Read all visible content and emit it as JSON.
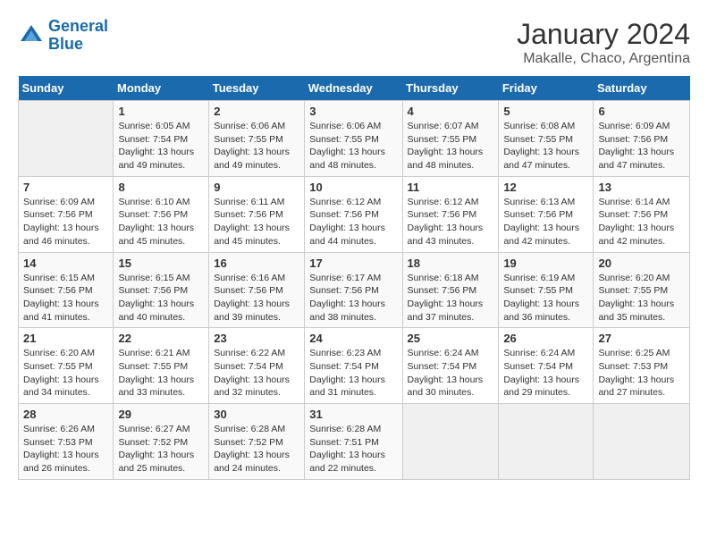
{
  "header": {
    "logo_line1": "General",
    "logo_line2": "Blue",
    "title": "January 2024",
    "subtitle": "Makalle, Chaco, Argentina"
  },
  "weekdays": [
    "Sunday",
    "Monday",
    "Tuesday",
    "Wednesday",
    "Thursday",
    "Friday",
    "Saturday"
  ],
  "weeks": [
    [
      {
        "day": "",
        "sunrise": "",
        "sunset": "",
        "daylight": ""
      },
      {
        "day": "1",
        "sunrise": "6:05 AM",
        "sunset": "7:54 PM",
        "daylight": "13 hours and 49 minutes."
      },
      {
        "day": "2",
        "sunrise": "6:06 AM",
        "sunset": "7:55 PM",
        "daylight": "13 hours and 49 minutes."
      },
      {
        "day": "3",
        "sunrise": "6:06 AM",
        "sunset": "7:55 PM",
        "daylight": "13 hours and 48 minutes."
      },
      {
        "day": "4",
        "sunrise": "6:07 AM",
        "sunset": "7:55 PM",
        "daylight": "13 hours and 48 minutes."
      },
      {
        "day": "5",
        "sunrise": "6:08 AM",
        "sunset": "7:55 PM",
        "daylight": "13 hours and 47 minutes."
      },
      {
        "day": "6",
        "sunrise": "6:09 AM",
        "sunset": "7:56 PM",
        "daylight": "13 hours and 47 minutes."
      }
    ],
    [
      {
        "day": "7",
        "sunrise": "6:09 AM",
        "sunset": "7:56 PM",
        "daylight": "13 hours and 46 minutes."
      },
      {
        "day": "8",
        "sunrise": "6:10 AM",
        "sunset": "7:56 PM",
        "daylight": "13 hours and 45 minutes."
      },
      {
        "day": "9",
        "sunrise": "6:11 AM",
        "sunset": "7:56 PM",
        "daylight": "13 hours and 45 minutes."
      },
      {
        "day": "10",
        "sunrise": "6:12 AM",
        "sunset": "7:56 PM",
        "daylight": "13 hours and 44 minutes."
      },
      {
        "day": "11",
        "sunrise": "6:12 AM",
        "sunset": "7:56 PM",
        "daylight": "13 hours and 43 minutes."
      },
      {
        "day": "12",
        "sunrise": "6:13 AM",
        "sunset": "7:56 PM",
        "daylight": "13 hours and 42 minutes."
      },
      {
        "day": "13",
        "sunrise": "6:14 AM",
        "sunset": "7:56 PM",
        "daylight": "13 hours and 42 minutes."
      }
    ],
    [
      {
        "day": "14",
        "sunrise": "6:15 AM",
        "sunset": "7:56 PM",
        "daylight": "13 hours and 41 minutes."
      },
      {
        "day": "15",
        "sunrise": "6:15 AM",
        "sunset": "7:56 PM",
        "daylight": "13 hours and 40 minutes."
      },
      {
        "day": "16",
        "sunrise": "6:16 AM",
        "sunset": "7:56 PM",
        "daylight": "13 hours and 39 minutes."
      },
      {
        "day": "17",
        "sunrise": "6:17 AM",
        "sunset": "7:56 PM",
        "daylight": "13 hours and 38 minutes."
      },
      {
        "day": "18",
        "sunrise": "6:18 AM",
        "sunset": "7:56 PM",
        "daylight": "13 hours and 37 minutes."
      },
      {
        "day": "19",
        "sunrise": "6:19 AM",
        "sunset": "7:55 PM",
        "daylight": "13 hours and 36 minutes."
      },
      {
        "day": "20",
        "sunrise": "6:20 AM",
        "sunset": "7:55 PM",
        "daylight": "13 hours and 35 minutes."
      }
    ],
    [
      {
        "day": "21",
        "sunrise": "6:20 AM",
        "sunset": "7:55 PM",
        "daylight": "13 hours and 34 minutes."
      },
      {
        "day": "22",
        "sunrise": "6:21 AM",
        "sunset": "7:55 PM",
        "daylight": "13 hours and 33 minutes."
      },
      {
        "day": "23",
        "sunrise": "6:22 AM",
        "sunset": "7:54 PM",
        "daylight": "13 hours and 32 minutes."
      },
      {
        "day": "24",
        "sunrise": "6:23 AM",
        "sunset": "7:54 PM",
        "daylight": "13 hours and 31 minutes."
      },
      {
        "day": "25",
        "sunrise": "6:24 AM",
        "sunset": "7:54 PM",
        "daylight": "13 hours and 30 minutes."
      },
      {
        "day": "26",
        "sunrise": "6:24 AM",
        "sunset": "7:54 PM",
        "daylight": "13 hours and 29 minutes."
      },
      {
        "day": "27",
        "sunrise": "6:25 AM",
        "sunset": "7:53 PM",
        "daylight": "13 hours and 27 minutes."
      }
    ],
    [
      {
        "day": "28",
        "sunrise": "6:26 AM",
        "sunset": "7:53 PM",
        "daylight": "13 hours and 26 minutes."
      },
      {
        "day": "29",
        "sunrise": "6:27 AM",
        "sunset": "7:52 PM",
        "daylight": "13 hours and 25 minutes."
      },
      {
        "day": "30",
        "sunrise": "6:28 AM",
        "sunset": "7:52 PM",
        "daylight": "13 hours and 24 minutes."
      },
      {
        "day": "31",
        "sunrise": "6:28 AM",
        "sunset": "7:51 PM",
        "daylight": "13 hours and 22 minutes."
      },
      {
        "day": "",
        "sunrise": "",
        "sunset": "",
        "daylight": ""
      },
      {
        "day": "",
        "sunrise": "",
        "sunset": "",
        "daylight": ""
      },
      {
        "day": "",
        "sunrise": "",
        "sunset": "",
        "daylight": ""
      }
    ]
  ]
}
